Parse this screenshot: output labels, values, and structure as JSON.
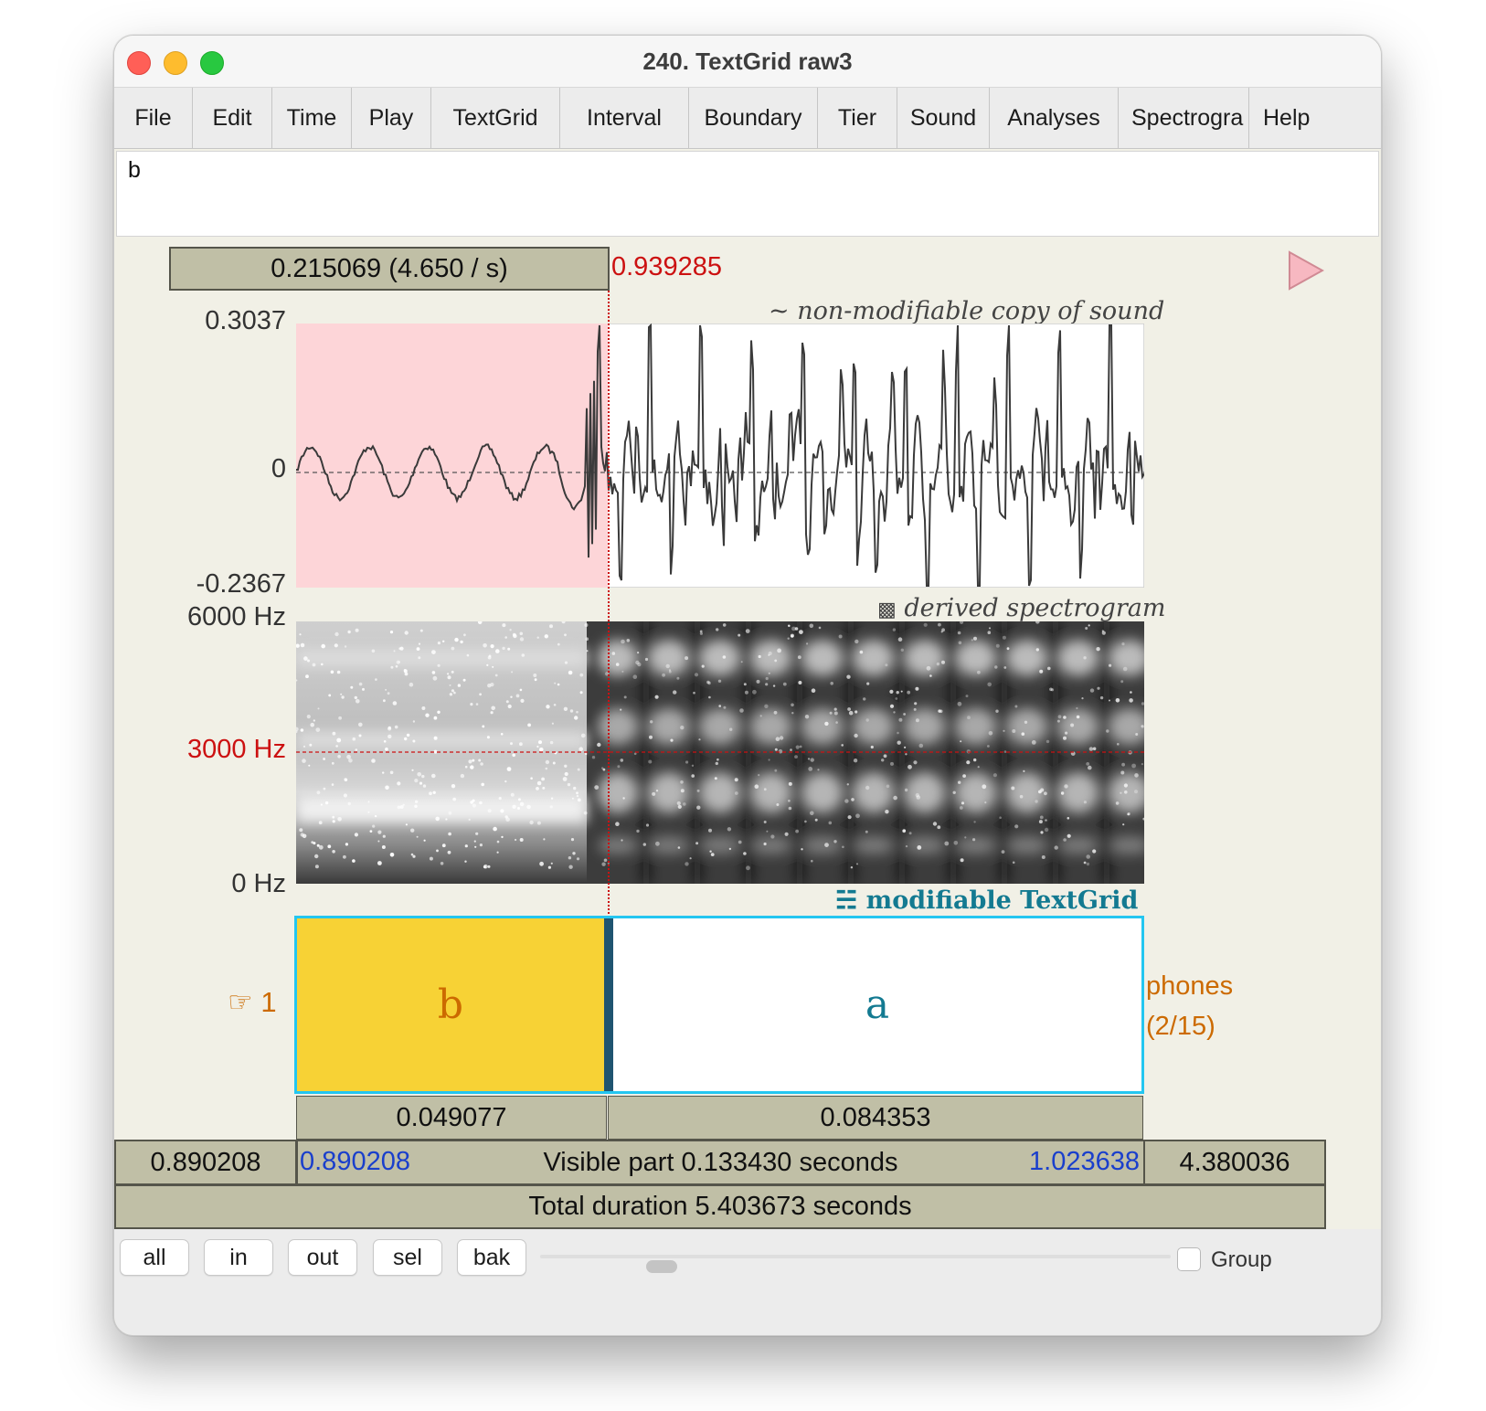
{
  "window": {
    "title": "240. TextGrid raw3"
  },
  "menu": [
    "File",
    "Edit",
    "Time",
    "Play",
    "TextGrid",
    "Interval",
    "Boundary",
    "Tier",
    "Sound",
    "Analyses",
    "Spectrogra",
    "Help"
  ],
  "text_field": {
    "value": "b"
  },
  "selection": {
    "box_text": "0.215069 (4.650 / s)",
    "cursor_time": "0.939285"
  },
  "sound": {
    "caption": "non-modifiable copy of sound",
    "caption_icon": "~",
    "y_max": "0.3037",
    "y_zero": "0",
    "y_min": "-0.2367"
  },
  "spectrogram": {
    "caption": "derived spectrogram",
    "caption_icon": "▩",
    "f_max": "6000 Hz",
    "f_cursor": "3000 Hz",
    "f_min": "0 Hz"
  },
  "textgrid": {
    "caption": "modifiable TextGrid",
    "caption_icon": "☵",
    "tier_pointer": "☞",
    "tier_number": "1",
    "tier_name": "phones",
    "tier_count": "(2/15)",
    "intervals": [
      {
        "label": "b",
        "duration": "0.049077"
      },
      {
        "label": "a",
        "duration": "0.084353"
      }
    ]
  },
  "time_bar": {
    "left_hidden": "0.890208",
    "visible_start": "0.890208",
    "visible_text": "Visible part 0.133430 seconds",
    "visible_end": "1.023638",
    "right_hidden": "4.380036",
    "total_text": "Total duration 5.403673 seconds"
  },
  "bottom_buttons": [
    "all",
    "in",
    "out",
    "sel",
    "bak"
  ],
  "group_label": "Group",
  "colors": {
    "selection_fill": "#fdd5d8",
    "cursor_red": "#cc1111",
    "interval_selected": "#f7d235",
    "tier_frame": "#24c6f0",
    "tier_orange": "#cc6a00",
    "textgrid_teal": "#137a91",
    "time_blue": "#1a3fcc"
  }
}
